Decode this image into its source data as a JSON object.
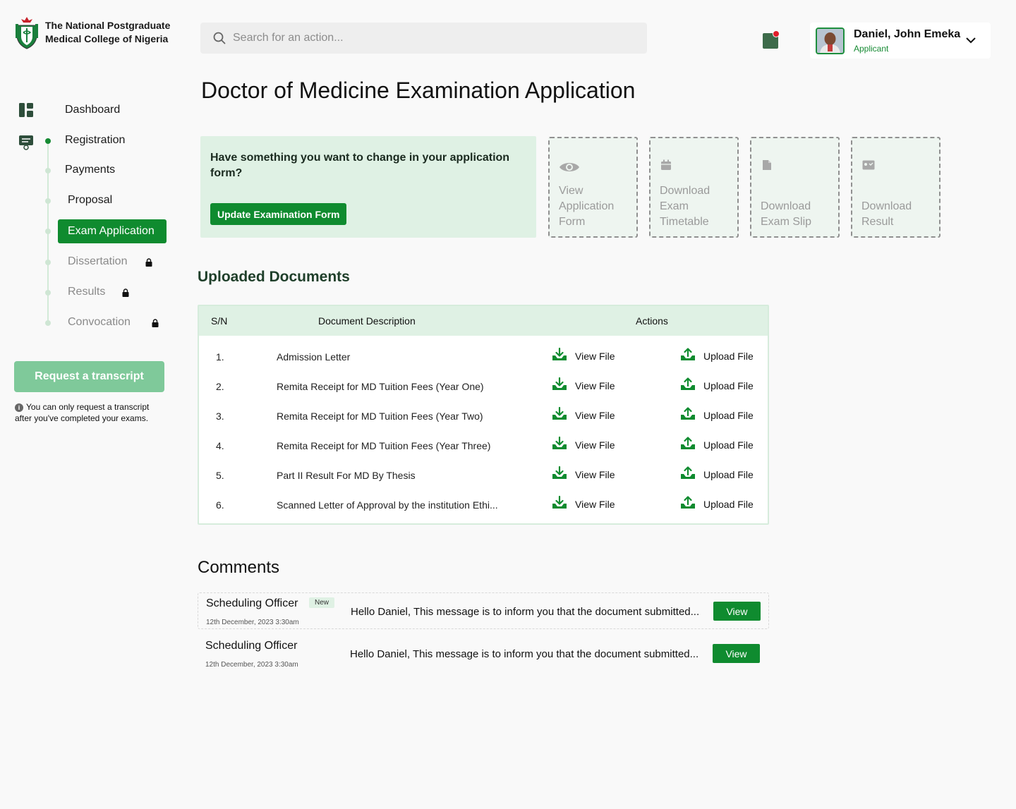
{
  "brand": {
    "name_line1": "The National Postgraduate",
    "name_line2": "Medical College of Nigeria"
  },
  "search": {
    "placeholder": "Search for an action..."
  },
  "user": {
    "name": "Daniel, John Emeka",
    "role": "Applicant"
  },
  "page_title": "Doctor of Medicine Examination Application",
  "sidebar": {
    "items": [
      {
        "label": "Dashboard"
      },
      {
        "label": "Registration"
      },
      {
        "label": "Payments"
      },
      {
        "label": "Proposal"
      },
      {
        "label": "Exam Application"
      },
      {
        "label": "Dissertation"
      },
      {
        "label": "Results"
      },
      {
        "label": "Convocation"
      }
    ],
    "transcript_button": "Request a transcript",
    "transcript_note": "You can only request a transcript after you've completed your exams."
  },
  "change_card": {
    "text": "Have something you want to change in your application form?",
    "button": "Update Examination Form"
  },
  "actions": [
    {
      "label_lines": [
        "View",
        "Application",
        "Form"
      ],
      "icon": "eye-icon"
    },
    {
      "label_lines": [
        "Download",
        "Exam",
        "Timetable"
      ],
      "icon": "calendar-icon"
    },
    {
      "label_lines": [
        "Download",
        "Exam Slip"
      ],
      "icon": "file-icon"
    },
    {
      "label_lines": [
        "Download",
        "Result"
      ],
      "icon": "id-card-icon"
    }
  ],
  "documents": {
    "title": "Uploaded Documents",
    "headers": [
      "S/N",
      "Document Description",
      "Actions"
    ],
    "view_label": "View File",
    "upload_label": "Upload File",
    "rows": [
      {
        "sn": "1.",
        "desc": "Admission Letter"
      },
      {
        "sn": "2.",
        "desc": "Remita Receipt for MD Tuition Fees (Year One)"
      },
      {
        "sn": "3.",
        "desc": "Remita Receipt for MD Tuition Fees (Year Two)"
      },
      {
        "sn": "4.",
        "desc": "Remita Receipt for MD Tuition Fees (Year Three)"
      },
      {
        "sn": "5.",
        "desc": "Part II Result For MD By Thesis"
      },
      {
        "sn": "6.",
        "desc": "Scanned Letter of Approval by the institution Ethi..."
      }
    ]
  },
  "comments": {
    "title": "Comments",
    "view_label": "View",
    "items": [
      {
        "author": "Scheduling Officer",
        "badge": "New",
        "date": "12th December, 2023  3:30am",
        "message": "Hello Daniel, This message is to inform you that the document submitted..."
      },
      {
        "author": "Scheduling Officer",
        "badge": "",
        "date": "12th December, 2023  3:30am",
        "message": "Hello Daniel, This message is to inform you that the document submitted..."
      }
    ]
  },
  "colors": {
    "primary": "#0f8b2f",
    "light_green": "#dff1e4",
    "disabled_green": "#7fc99a"
  }
}
